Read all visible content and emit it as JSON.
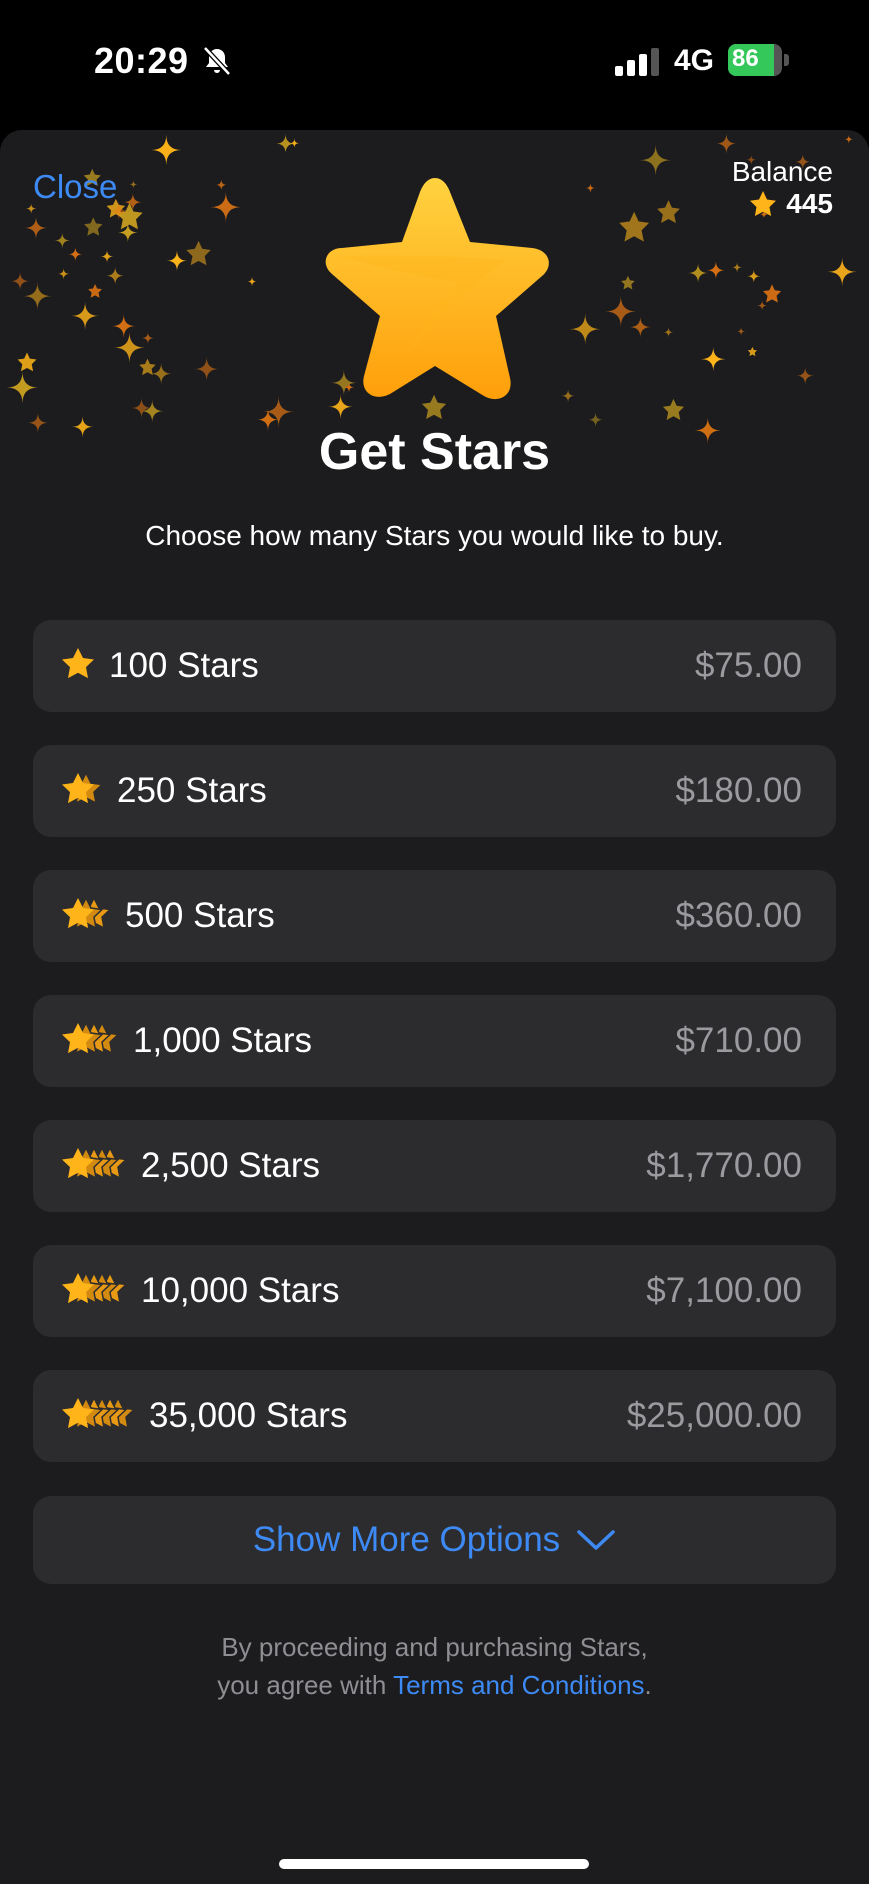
{
  "status_bar": {
    "time": "20:29",
    "network": "4G",
    "battery": "86",
    "battery_level": 0.86
  },
  "header": {
    "close_label": "Close",
    "balance_label": "Balance",
    "balance_value": "445",
    "title": "Get Stars",
    "subtitle": "Choose how many Stars you would like to buy."
  },
  "options": [
    {
      "stars": "100 Stars",
      "price": "$75.00",
      "tier": 1
    },
    {
      "stars": "250 Stars",
      "price": "$180.00",
      "tier": 2
    },
    {
      "stars": "500 Stars",
      "price": "$360.00",
      "tier": 3
    },
    {
      "stars": "1,000 Stars",
      "price": "$710.00",
      "tier": 4
    },
    {
      "stars": "2,500 Stars",
      "price": "$1,770.00",
      "tier": 5
    },
    {
      "stars": "10,000 Stars",
      "price": "$7,100.00",
      "tier": 5
    },
    {
      "stars": "35,000 Stars",
      "price": "$25,000.00",
      "tier": 6
    }
  ],
  "show_more_label": "Show More Options",
  "legal": {
    "line1": "By proceeding and purchasing Stars,",
    "line2_prefix": "you agree with ",
    "terms_link": "Terms and Conditions",
    "line2_suffix": "."
  },
  "colors": {
    "accent": "#3e8af5",
    "star_gold": "#ffb419",
    "star_orange": "#f07c13",
    "background": "#1c1c1e",
    "row": "#2c2c2e"
  }
}
